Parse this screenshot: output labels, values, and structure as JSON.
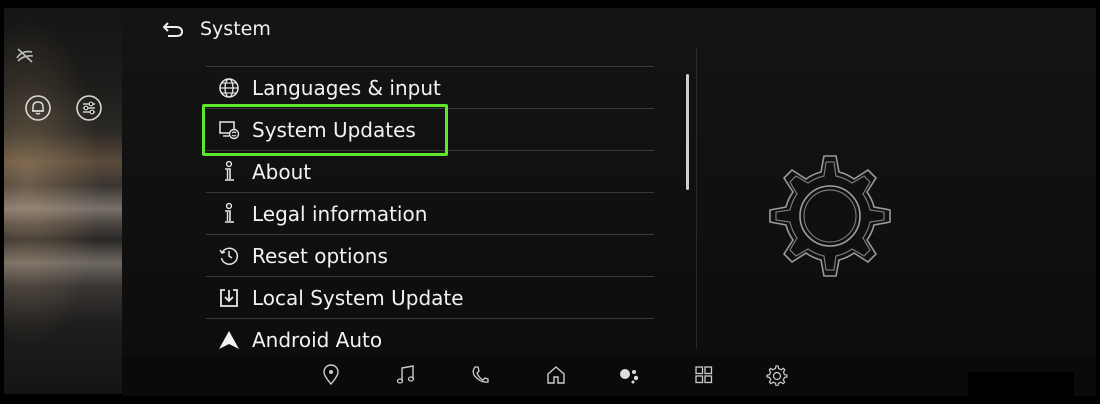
{
  "header": {
    "title": "System"
  },
  "menu": {
    "items": [
      {
        "label": "Languages & input",
        "icon": "globe-icon"
      },
      {
        "label": "System Updates",
        "icon": "system-update-icon"
      },
      {
        "label": "About",
        "icon": "info-icon"
      },
      {
        "label": "Legal information",
        "icon": "info-icon"
      },
      {
        "label": "Reset options",
        "icon": "history-icon"
      },
      {
        "label": "Local System Update",
        "icon": "download-box-icon"
      },
      {
        "label": "Android Auto",
        "icon": "android-auto-icon"
      }
    ],
    "highlighted_index": 1
  },
  "left_panel": {
    "icons": [
      "driver-assist-off-icon",
      "bell-icon",
      "sliders-icon"
    ]
  },
  "dock": {
    "icons": [
      "location-pin-icon",
      "music-note-icon",
      "phone-icon",
      "home-icon",
      "assistant-icon",
      "apps-grid-icon",
      "settings-gear-icon"
    ]
  },
  "colors": {
    "highlight": "#5ee62d",
    "background": "#000000",
    "text": "#f2f2f2"
  }
}
